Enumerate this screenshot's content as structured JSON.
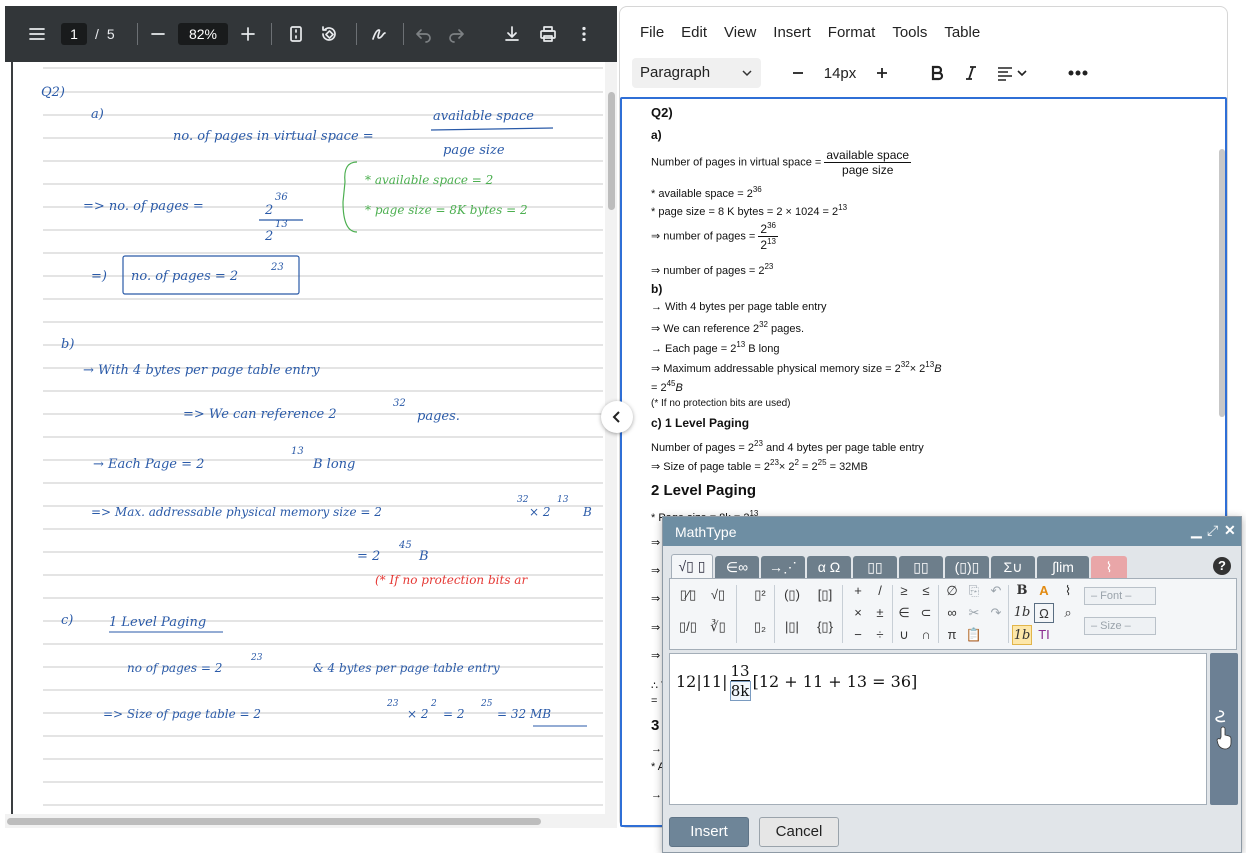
{
  "pdf_viewer": {
    "page_current": "1",
    "page_total": "5",
    "page_separator": "/",
    "zoom": "82%",
    "handwritten": {
      "q_label": "Q2)",
      "part_a": "a)",
      "lines_a": [
        "no. of pages in virtual space =",
        "available space",
        "page size",
        "* available space = 2",
        "* page size = 8K bytes = 2",
        "=> no. of pages =",
        "2",
        "36",
        "2",
        "13",
        "no. of pages = 2",
        "23"
      ],
      "part_b": "b)",
      "lines_b": [
        "→ With 4 bytes per page table entry",
        "=> We can reference 2",
        "32",
        "pages.",
        "→ Each Page = 2",
        "13",
        "B long",
        "=> Max. addressable physical memory size = 2",
        "32",
        "× 2",
        "13",
        "B",
        "= 2",
        "45",
        "B",
        "(* If no protection bits ar"
      ],
      "part_c": "c)",
      "lines_c": [
        "1 Level Paging",
        "no of pages = 2",
        "23",
        "& 4 bytes per page table entry",
        "=> Size of page table = 2",
        "23",
        "× 2",
        "2",
        "= 2",
        "25",
        "= 32 MB"
      ]
    }
  },
  "editor": {
    "menu": [
      "File",
      "Edit",
      "View",
      "Insert",
      "Format",
      "Tools",
      "Table"
    ],
    "block_format": "Paragraph",
    "font_size": "14px",
    "content": {
      "q_heading": "Q2)",
      "a_heading": "a)",
      "pages_virtual_label": "Number of pages in virtual space =",
      "pages_virtual_num": "available space",
      "pages_virtual_den": "page size",
      "avail_space": "* available space = 2",
      "avail_exp": "36",
      "page_size": "* page size = 8 K bytes = 2 × 1024 = 2",
      "page_size_exp": "13",
      "num_pages_1_label": "⇒ number of pages =",
      "num_pages_1_num": "2",
      "num_pages_1_num_exp": "36",
      "num_pages_1_den": "2",
      "num_pages_1_den_exp": "13",
      "num_pages_2": "⇒ number of pages = 2",
      "num_pages_2_exp": "23",
      "b_heading": "b)",
      "b_line1": "→ With 4 bytes per page table entry",
      "b_line2": "⇒ We can reference 2",
      "b_line2_exp": "32",
      "b_line2_tail": " pages.",
      "b_line3": "→ Each page = 2",
      "b_line3_exp": "13",
      "b_line3_tail": " B long",
      "b_line4": "⇒ Maximum addressable physical memory size = 2",
      "b_line4_exp1": "32",
      "b_line4_mid": "× 2",
      "b_line4_exp2": "13",
      "b_line4_tail": "B",
      "b_line5": "= 2",
      "b_line5_exp": "45",
      "b_line5_tail": "B",
      "b_line6": "(* If no protection bits are used)",
      "c_heading": "c) 1 Level Paging",
      "c_line1": "Number of pages = 2",
      "c_line1_exp": "23",
      "c_line1_tail": " and 4 bytes per page table entry",
      "c_line2": "⇒ Size of page table = 2",
      "c_line2_exp1": "23",
      "c_line2_mid1": "× 2",
      "c_line2_exp2": "2",
      "c_line2_mid2": " = 2",
      "c_line2_exp3": "25",
      "c_line2_tail": " = 32MB",
      "level2_heading": "2 Level Paging",
      "level2_line1": "* Page size = 8k = 2",
      "level2_line1_exp": "13",
      "partial_left": [
        "⇒",
        "⇒",
        "⇒",
        "⇒",
        "⇒",
        "∴ T",
        "=",
        "3",
        "→",
        "* A",
        "→",
        "→"
      ]
    }
  },
  "mathtype": {
    "title": "MathType",
    "tabs": [
      "√▯ ▯",
      "∈∞",
      "→⋰",
      "α Ω",
      "▯▯",
      "▯▯",
      "(▯)▯",
      "Σ∪",
      "∫lim",
      "⌇"
    ],
    "help": "?",
    "font_dropdown": "– Font –",
    "size_dropdown": "– Size –",
    "formula": {
      "prefix": "12|11|",
      "frac_num": "13",
      "frac_den": "8k",
      "suffix": "[12 + 11 + 13 = 36]"
    },
    "insert_label": "Insert",
    "cancel_label": "Cancel"
  }
}
